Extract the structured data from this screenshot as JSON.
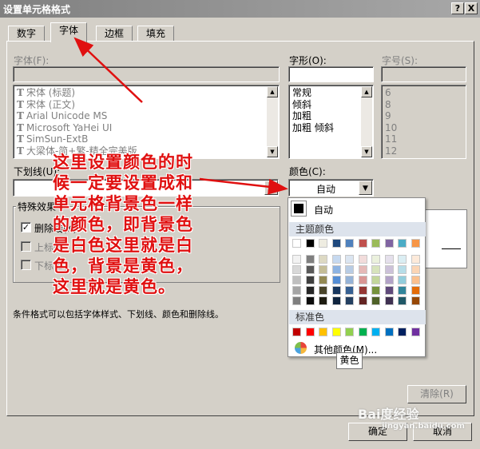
{
  "window": {
    "title": "设置单元格格式",
    "help_btn": "?",
    "close_btn": "X"
  },
  "tabs": [
    {
      "label": "数字",
      "active": false
    },
    {
      "label": "字体",
      "active": true
    },
    {
      "label": "边框",
      "active": false
    },
    {
      "label": "填充",
      "active": false
    }
  ],
  "font": {
    "label": "字体(F):",
    "items": [
      "宋体 (标题)",
      "宋体 (正文)",
      "Arial Unicode MS",
      "Microsoft YaHei UI",
      "SimSun-ExtB",
      "大梁体-简+繁-精全完美版"
    ]
  },
  "style": {
    "label": "字形(O):",
    "items": [
      "常规",
      "倾斜",
      "加粗",
      "加粗 倾斜"
    ]
  },
  "size": {
    "label": "字号(S):",
    "items": [
      "6",
      "8",
      "9",
      "10",
      "11",
      "12"
    ]
  },
  "underline": {
    "label": "下划线(U):"
  },
  "color": {
    "label": "颜色(C):",
    "value": "自动"
  },
  "effects": {
    "title": "特殊效果",
    "strike": "删除线(K)",
    "superscript": "上标(E)",
    "subscript": "下标(B)"
  },
  "note": "条件格式可以包括字体样式、下划线、颜色和删除线。",
  "buttons": {
    "clear": "清除(R)",
    "ok": "确定",
    "cancel": "取消"
  },
  "color_popup": {
    "auto": "自动",
    "theme_title": "主题颜色",
    "standard_title": "标准色",
    "more": "其他颜色(M)...",
    "theme_top": [
      "#ffffff",
      "#000000",
      "#eeece1",
      "#1f497d",
      "#4f81bd",
      "#c0504d",
      "#9bbb59",
      "#8064a2",
      "#4bacc6",
      "#f79646"
    ],
    "theme_shades": [
      [
        "#f2f2f2",
        "#d8d8d8",
        "#bfbfbf",
        "#a5a5a5",
        "#7f7f7f"
      ],
      [
        "#7f7f7f",
        "#595959",
        "#3f3f3f",
        "#262626",
        "#0c0c0c"
      ],
      [
        "#ddd9c3",
        "#c4bd97",
        "#938953",
        "#494429",
        "#1d1b10"
      ],
      [
        "#c6d9f0",
        "#8db3e2",
        "#548dd4",
        "#17365d",
        "#0f243e"
      ],
      [
        "#dbe5f1",
        "#b8cce4",
        "#95b3d7",
        "#366092",
        "#244061"
      ],
      [
        "#f2dcdb",
        "#e5b9b7",
        "#d99694",
        "#953734",
        "#632423"
      ],
      [
        "#ebf1dd",
        "#d7e3bc",
        "#c3d69b",
        "#76923c",
        "#4f6128"
      ],
      [
        "#e5e0ec",
        "#ccc1d9",
        "#b2a2c7",
        "#5f497a",
        "#3f3151"
      ],
      [
        "#dbeef3",
        "#b7dde8",
        "#92cddc",
        "#31859b",
        "#205867"
      ],
      [
        "#fdeada",
        "#fbd5b5",
        "#fac08f",
        "#e36c09",
        "#974806"
      ]
    ],
    "standard": [
      "#c00000",
      "#ff0000",
      "#ffc000",
      "#ffff00",
      "#92d050",
      "#00b050",
      "#00b0f0",
      "#0070c0",
      "#002060",
      "#7030a0"
    ]
  },
  "tooltip": "黄色",
  "annotation": "这里设置颜色的时候一定要设置成和单元格背景色一样的颜色，即背景色是白色这里就是白色，背景是黄色，这里就是黄色。",
  "watermark": {
    "main": "Bai度经验",
    "sub": "jingyan.baidu.com"
  }
}
